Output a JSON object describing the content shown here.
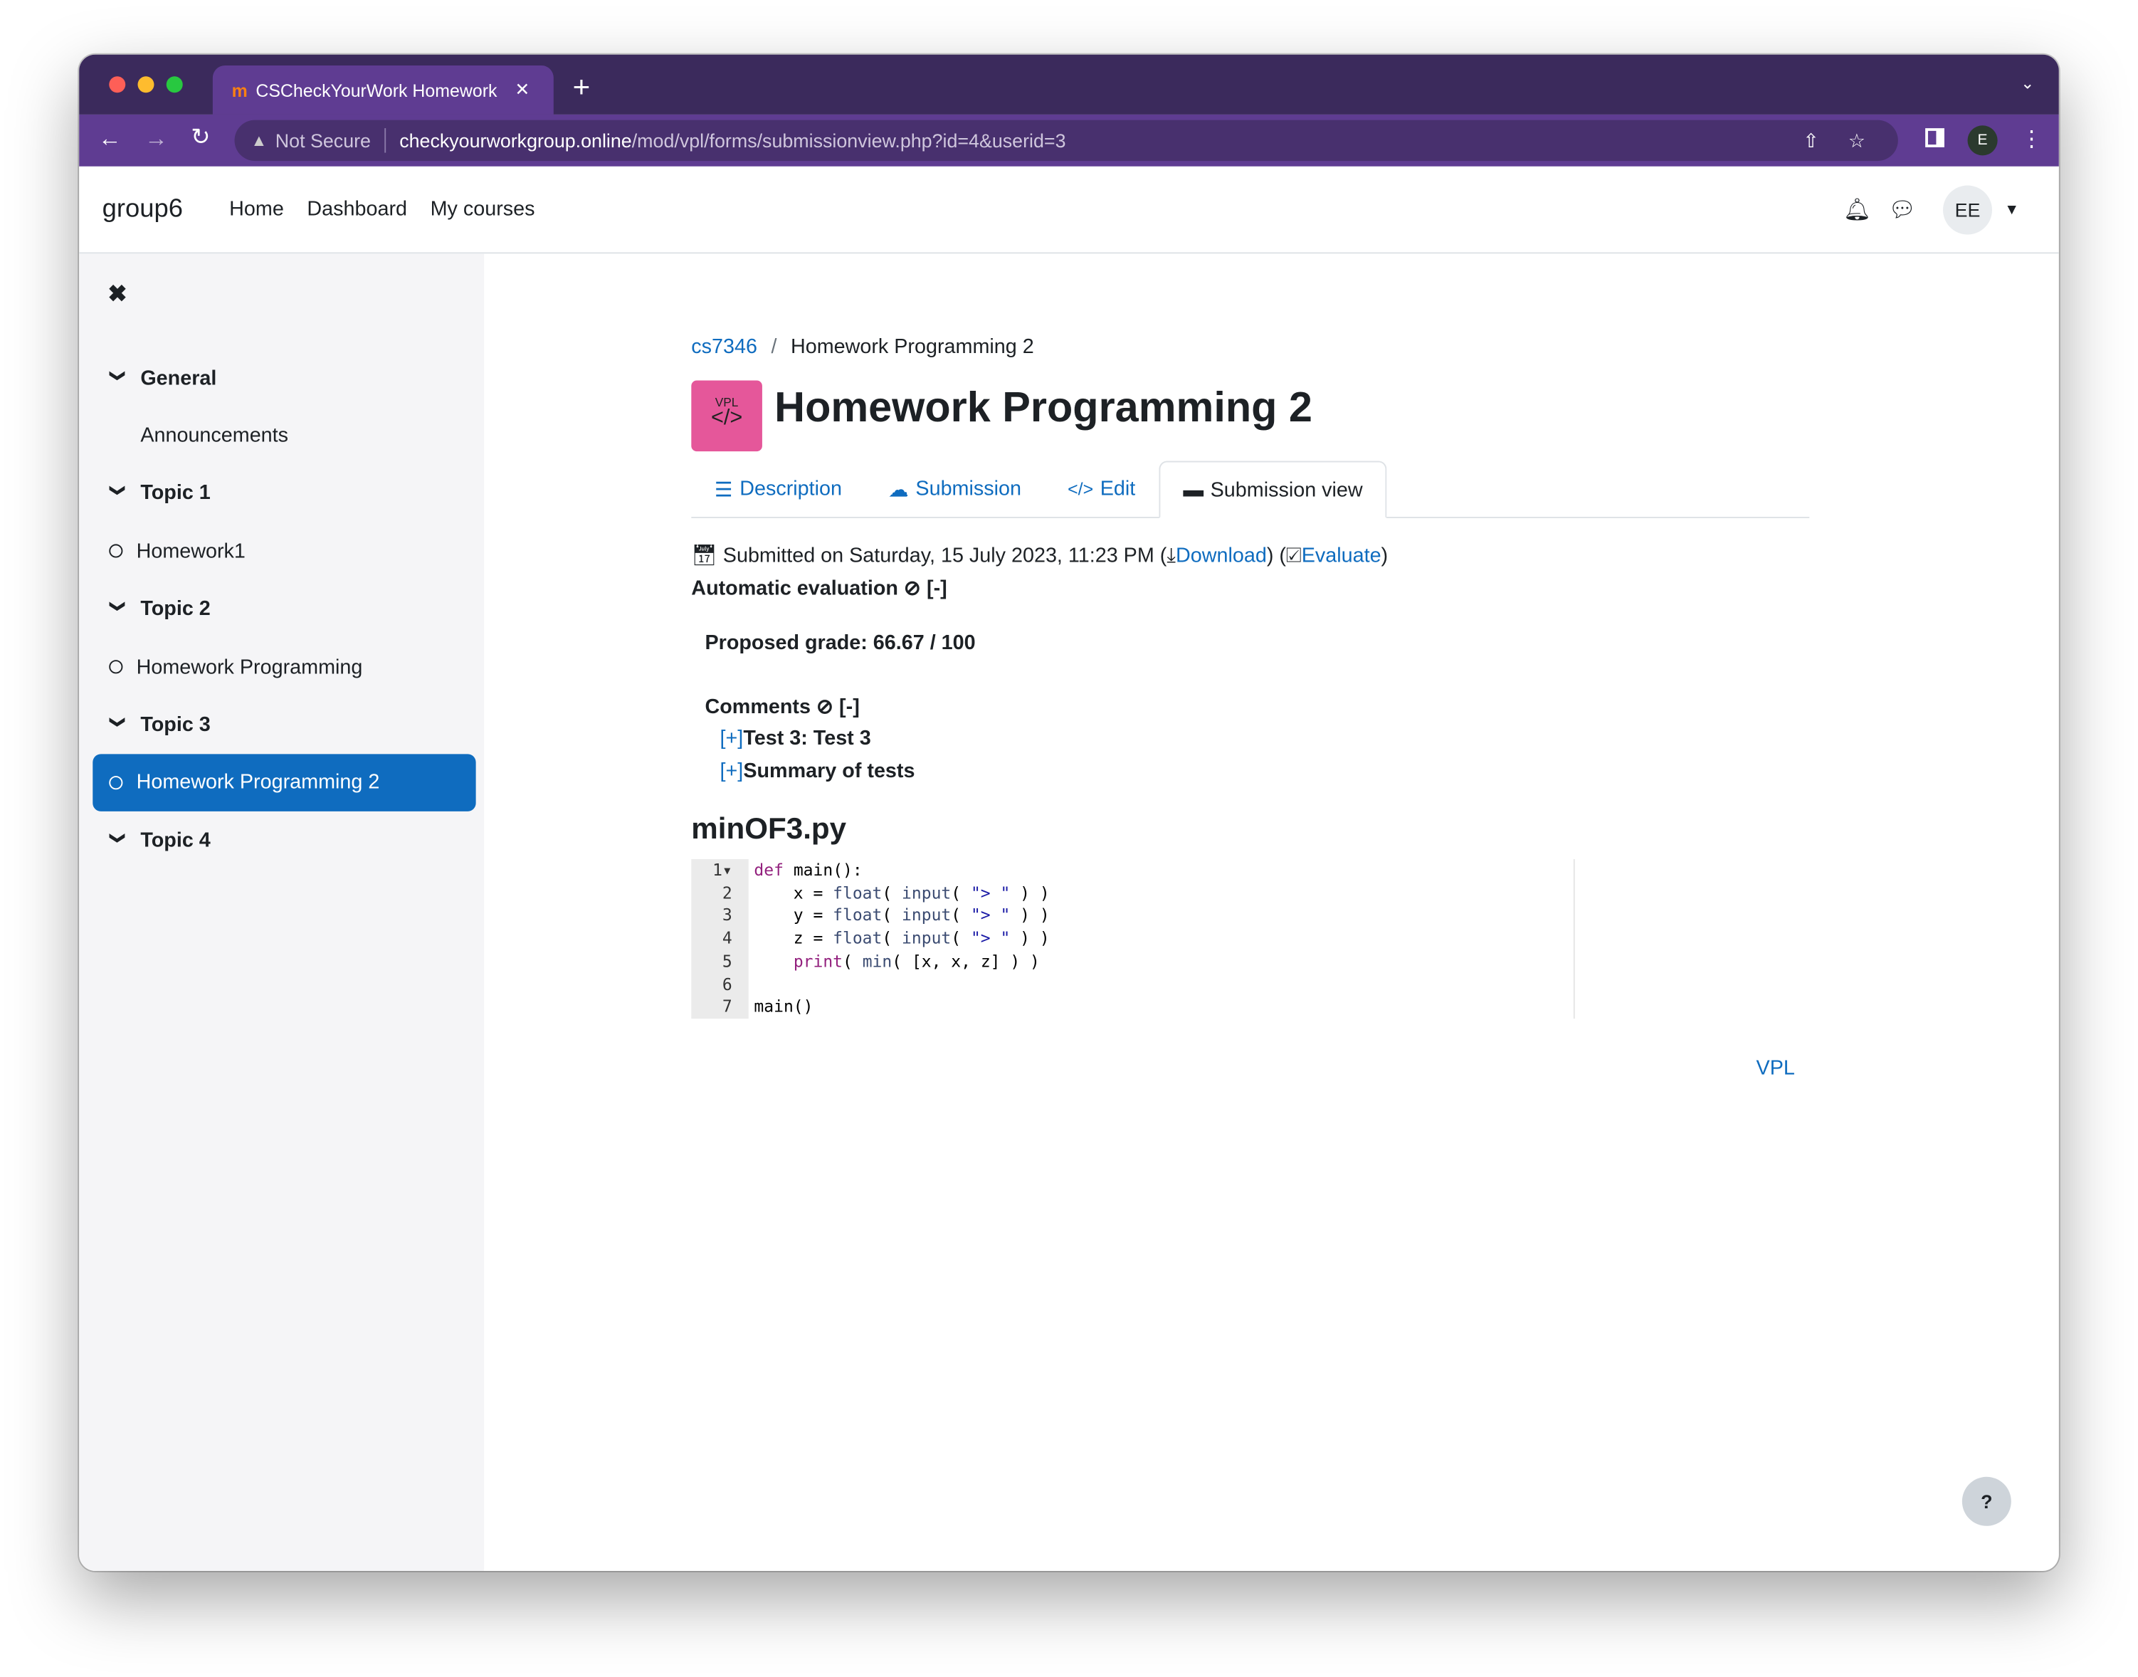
{
  "browser": {
    "tab_title": "CSCheckYourWork Homework",
    "security": "Not Secure",
    "url_host": "checkyourworkgroup.online",
    "url_path": "/mod/vpl/forms/submissionview.php?id=4&userid=3",
    "profile_initial": "E",
    "colors": {
      "tabbar": "#3b2a5c",
      "toolbar": "#5f3c92"
    }
  },
  "header": {
    "site": "group6",
    "nav": [
      "Home",
      "Dashboard",
      "My courses"
    ],
    "avatar": "EE"
  },
  "sidebar": {
    "items": [
      {
        "label": "General",
        "type": "section"
      },
      {
        "label": "Announcements",
        "type": "item"
      },
      {
        "label": "Topic 1",
        "type": "section"
      },
      {
        "label": "Homework1",
        "type": "activity"
      },
      {
        "label": "Topic 2",
        "type": "section"
      },
      {
        "label": "Homework Programming",
        "type": "activity"
      },
      {
        "label": "Topic 3",
        "type": "section"
      },
      {
        "label": "Homework Programming 2",
        "type": "activity",
        "active": true
      },
      {
        "label": "Topic 4",
        "type": "section"
      }
    ],
    "accent": "#0f6cbf"
  },
  "breadcrumb": {
    "course": "cs7346",
    "current": "Homework Programming 2"
  },
  "page": {
    "icon_label": "VPL",
    "title": "Homework Programming 2",
    "icon_color": "#e5579a"
  },
  "tabs": [
    {
      "label": "Description"
    },
    {
      "label": "Submission"
    },
    {
      "label": "Edit"
    },
    {
      "label": "Submission view",
      "active": true
    }
  ],
  "submission": {
    "submitted": "Submitted on Saturday, 15 July 2023, 11:23 PM (",
    "download": "Download",
    "mid": ") (",
    "evaluate": "Evaluate",
    "end": ")",
    "auto_eval": "Automatic evaluation",
    "toggle": "[-]",
    "grade": "Proposed grade: 66.67 / 100",
    "comments": "Comments",
    "comments_toggle": "[-]",
    "comment_items": [
      {
        "toggle": "[+]",
        "label": "Test 3: Test 3"
      },
      {
        "toggle": "[+]",
        "label": "Summary of tests"
      }
    ]
  },
  "file": {
    "name": "minOF3.py",
    "lines": [
      "def main():",
      "    x = float( input( \"> \" ) )",
      "    y = float( input( \"> \" ) )",
      "    z = float( input( \"> \" ) )",
      "    print( min( [x, x, z] ) )",
      "",
      "main()"
    ]
  },
  "footer": {
    "vpl_link": "VPL",
    "help": "?"
  }
}
